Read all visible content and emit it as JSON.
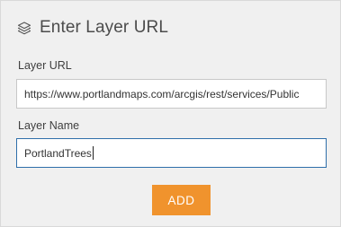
{
  "header": {
    "title": "Enter Layer URL",
    "icon": "layers-icon"
  },
  "layer_url": {
    "label": "Layer URL",
    "value": "https://www.portlandmaps.com/arcgis/rest/services/Public"
  },
  "layer_name": {
    "label": "Layer Name",
    "value": "PortlandTrees"
  },
  "actions": {
    "add_label": "ADD"
  },
  "colors": {
    "panel_bg": "#f0f0f0",
    "accent_button": "#f0932d",
    "focus_border": "#2f6faa"
  }
}
